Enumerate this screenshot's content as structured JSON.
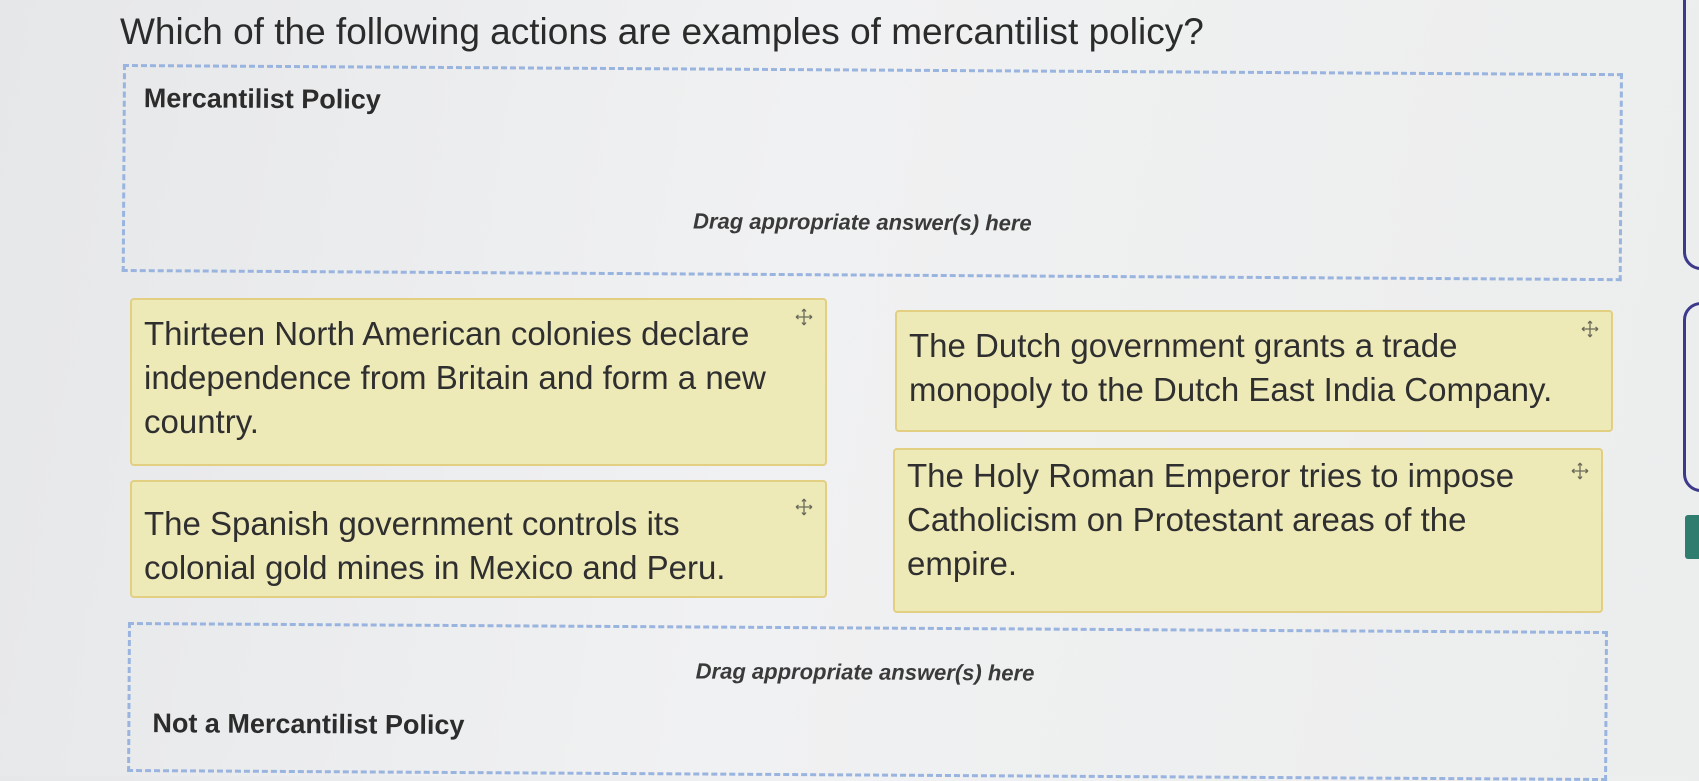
{
  "question": {
    "text": "Which of the following actions are examples of mercantilist policy?"
  },
  "zones": {
    "top": {
      "title": "Mercantilist Policy",
      "hint": "Drag appropriate answer(s) here"
    },
    "bottom": {
      "title": "Not a Mercantilist Policy",
      "hint": "Drag appropriate answer(s) here"
    }
  },
  "cards": [
    {
      "text": "Thirteen North American colonies declare independence from Britain and form a new country.",
      "icon": "move-icon"
    },
    {
      "text": "The Dutch government grants a trade monopoly to the Dutch East India Company.",
      "icon": "move-icon"
    },
    {
      "text": "The Spanish government controls its colonial gold mines in Mexico and Peru.",
      "icon": "move-icon"
    },
    {
      "text": "The Holy Roman Emperor tries to impose Catholicism on Protestant areas of the empire.",
      "icon": "move-icon"
    }
  ],
  "colors": {
    "card_background": "#eeeab8",
    "card_border": "#e3cf82",
    "dropzone_border": "#9ab4e0",
    "edge_ring": "#3d3a8c",
    "edge_tab": "#2e7d6e"
  }
}
